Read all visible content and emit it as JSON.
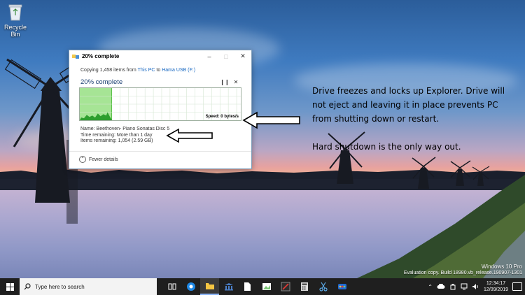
{
  "desktop": {
    "recycle_bin_label": "Recycle Bin"
  },
  "dialog": {
    "title": "20% complete",
    "copy_prefix": "Copying 1,458 items from ",
    "source": "This PC",
    "copy_middle": " to ",
    "destination": "Hama USB (F:)",
    "percent_text": "20% complete",
    "progress": 0.2,
    "speed": "Speed: 0 bytes/s",
    "name_line": "Name: Beethoven- Piano Sonatas Disc 5",
    "time_remaining": "Time remaining: More than 1 day",
    "items_remaining": "Items remaining: 1,054 (2.59 GB)",
    "fewer_details": "Fewer details"
  },
  "annotation": {
    "paragraph1": "Drive freezes and locks up Explorer. Drive will not eject and leaving it in place prevents PC from shutting down or restart.",
    "paragraph2": "Hard shutdown is the only way out."
  },
  "watermark": {
    "edition": "Windows 10 Pro",
    "build": "Evaluation copy. Build 18980.vb_release.190907-1301"
  },
  "taskbar": {
    "search_placeholder": "Type here to search",
    "apps": [
      "task-view",
      "edge",
      "file-explorer",
      "bank",
      "document",
      "photos",
      "media",
      "calculator",
      "snipping",
      "paint"
    ],
    "active_app": "file-explorer",
    "time": "12:34:17",
    "date": "12/09/2019"
  },
  "colors": {
    "progress_fill": "#a6e495",
    "progress_line": "#5bc04b",
    "link": "#1566c0",
    "taskbar": "#1f1f1f"
  }
}
